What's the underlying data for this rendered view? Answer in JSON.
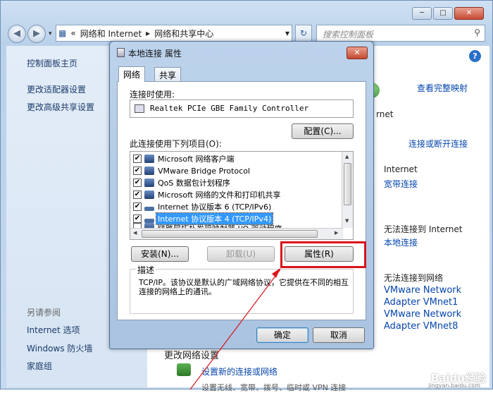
{
  "explorer": {
    "breadcrumb": [
      "«",
      "网络和 Internet",
      "▸",
      "网络和共享中心",
      "▾"
    ],
    "search_placeholder": "搜索控制面板",
    "left_links": [
      "控制面板主页",
      "更改适配器设置",
      "更改高级共享设置"
    ],
    "see_also_heading": "另请参阅",
    "see_also": [
      "Internet 选项",
      "Windows 防火墙",
      "家庭组"
    ]
  },
  "main": {
    "view_full_map": "查看完整映射",
    "net_partial": "rnet",
    "connect_disconnect": "连接或断开连接",
    "internet_label": "Internet",
    "broadband_link": "宽带连接",
    "no_internet_1": "无法连接到 Internet",
    "local_link": "本地连接",
    "no_network": "无法连接到网络",
    "vm1_line1": "VMware Network",
    "vm1_line2": "Adapter VMnet1",
    "vm8_line1": "VMware Network",
    "vm8_line2": "Adapter VMnet8",
    "change_settings": "更改网络设置",
    "setup_link": "设置新的连接或网络",
    "bottom_partial": "设置无线、宽带、拨号、临时或 VPN 连接"
  },
  "dialog": {
    "title": "本地连接 属性",
    "tabs": [
      "网络",
      "共享"
    ],
    "connect_using": "连接时使用:",
    "adapter": "Realtek PCIe GBE Family Controller",
    "configure": "配置(C)...",
    "items_label": "此连接使用下列项目(O):",
    "items": [
      {
        "label": "Microsoft 网络客户端",
        "checked": true
      },
      {
        "label": "VMware Bridge Protocol",
        "checked": true
      },
      {
        "label": "QoS 数据包计划程序",
        "checked": true
      },
      {
        "label": "Microsoft 网络的文件和打印机共享",
        "checked": true
      },
      {
        "label": "Internet 协议版本 6 (TCP/IPv6)",
        "checked": true
      },
      {
        "label": "Internet 协议版本 4 (TCP/IPv4)",
        "checked": true,
        "selected": true
      },
      {
        "label": "链路层拓扑发现映射器 I/O 驱动程序",
        "checked": true
      }
    ],
    "install": "安装(N)...",
    "uninstall": "卸载(U)",
    "properties": "属性(R)",
    "description_heading": "描述",
    "description": "TCP/IP。该协议是默认的广域网络协议，它提供在不同的相互连接的网络上的通讯。",
    "ok": "确定",
    "cancel": "取消"
  },
  "annotation_color": "#d9141b",
  "watermark": "Baidu经验",
  "watermark_url": "jingyan.baidu.com"
}
